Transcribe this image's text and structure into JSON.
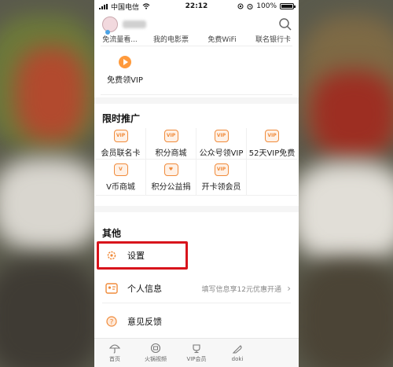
{
  "status_bar": {
    "carrier": "中国电信",
    "time": "22:12",
    "battery": "100%"
  },
  "header": {
    "avatar_icon": "avatar",
    "search_icon": "search-icon"
  },
  "top_partial_row": [
    "免流量看...",
    "我的电影票",
    "免费WiFi",
    "联名银行卡"
  ],
  "vip_item": {
    "label": "免费领VIP",
    "icon": "play-icon"
  },
  "promotions": {
    "title": "限时推广",
    "items": [
      {
        "label": "会员联名卡",
        "icon": "card-icon",
        "badge": "VIP"
      },
      {
        "label": "积分商城",
        "icon": "mall-icon",
        "badge": "VIP"
      },
      {
        "label": "公众号领VIP",
        "icon": "wechat-vip-icon",
        "badge": "VIP"
      },
      {
        "label": "52天VIP免费",
        "icon": "gift-vip-icon",
        "badge": "VIP"
      },
      {
        "label": "V币商城",
        "icon": "coin-icon",
        "badge": "V"
      },
      {
        "label": "积分公益捐",
        "icon": "charity-icon",
        "badge": "♥"
      },
      {
        "label": "开卡领会员",
        "icon": "open-card-icon",
        "badge": "VIP"
      }
    ]
  },
  "others": {
    "title": "其他",
    "items": [
      {
        "label": "设置",
        "icon": "gear-icon",
        "hint": ""
      },
      {
        "label": "个人信息",
        "icon": "profile-icon",
        "hint": "填写信息享12元优惠开通"
      },
      {
        "label": "意见反馈",
        "icon": "question-icon",
        "hint": ""
      }
    ]
  },
  "tabbar": [
    {
      "label": "首页",
      "icon": "umbrella-icon"
    },
    {
      "label": "火锅视频",
      "icon": "hotpot-icon"
    },
    {
      "label": "VIP会员",
      "icon": "vip-cup-icon"
    },
    {
      "label": "doki",
      "icon": "feather-icon"
    }
  ],
  "colors": {
    "accent": "#f08b3b",
    "highlight_border": "#d8141c"
  }
}
